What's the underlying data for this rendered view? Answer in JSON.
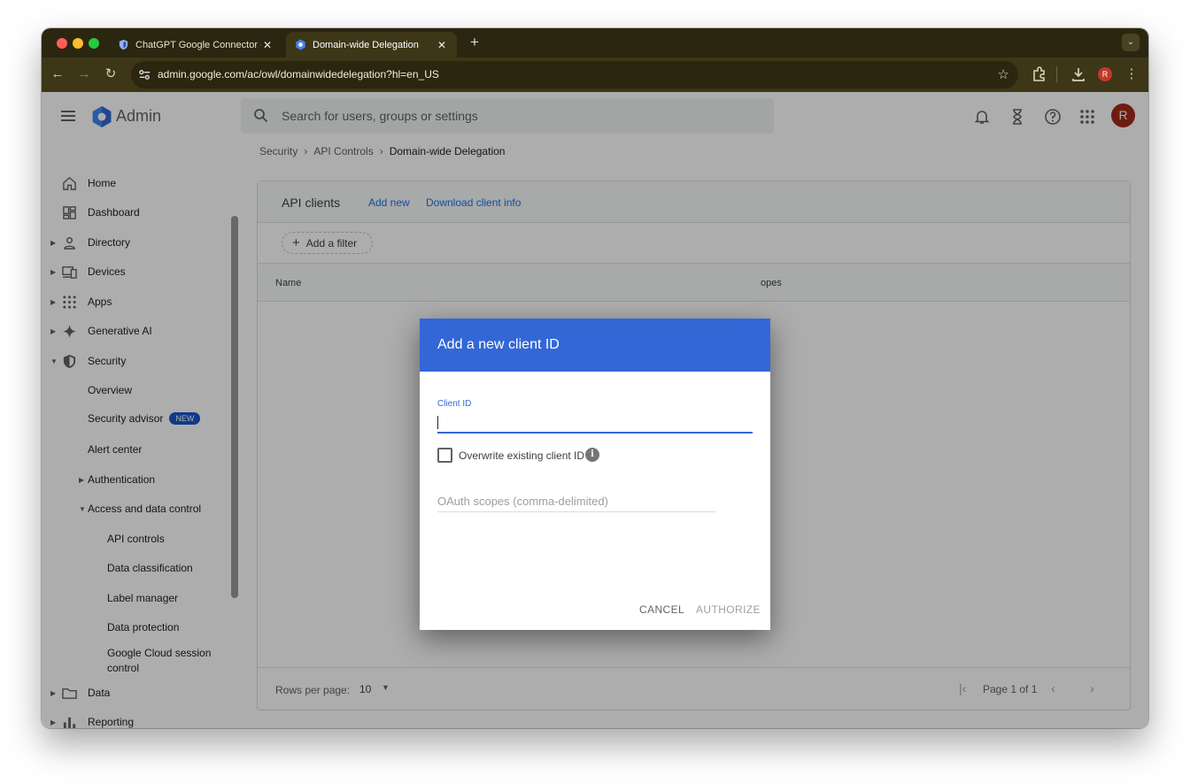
{
  "browser": {
    "tabs": [
      {
        "title": "ChatGPT Google Connector -",
        "active": false
      },
      {
        "title": "Domain-wide Delegation",
        "active": true
      }
    ],
    "url": "admin.google.com/ac/owl/domainwidedelegation?hl=en_US",
    "profile_initial": "R"
  },
  "app": {
    "brand": "Admin",
    "search_placeholder": "Search for users, groups or settings",
    "avatar_initial": "R"
  },
  "breadcrumb": [
    "Security",
    "API Controls",
    "Domain-wide Delegation"
  ],
  "sidebar": {
    "items": [
      {
        "label": "Home"
      },
      {
        "label": "Dashboard"
      },
      {
        "label": "Directory"
      },
      {
        "label": "Devices"
      },
      {
        "label": "Apps"
      },
      {
        "label": "Generative AI"
      },
      {
        "label": "Security"
      },
      {
        "label": "Overview"
      },
      {
        "label": "Security advisor",
        "badge": "NEW"
      },
      {
        "label": "Alert center"
      },
      {
        "label": "Authentication"
      },
      {
        "label": "Access and data control"
      },
      {
        "label": "API controls"
      },
      {
        "label": "Data classification"
      },
      {
        "label": "Label manager"
      },
      {
        "label": "Data protection"
      },
      {
        "label": "Google Cloud session"
      },
      {
        "label": "control"
      },
      {
        "label": "Data"
      },
      {
        "label": "Reporting"
      }
    ]
  },
  "card": {
    "title": "API clients",
    "add_new": "Add new",
    "download": "Download client info",
    "filter": "Add a filter",
    "col_name": "Name",
    "col_scopes": "opes",
    "rows_per_page_label": "Rows per page:",
    "rows_per_page_value": "10",
    "pager": "Page 1 of 1"
  },
  "dialog": {
    "title": "Add a new client ID",
    "client_id_label": "Client ID",
    "client_id_value": "",
    "overwrite_label": "Overwrite existing client ID",
    "overwrite_checked": false,
    "oauth_placeholder": "OAuth scopes (comma-delimited)",
    "cancel": "CANCEL",
    "authorize": "AUTHORIZE"
  }
}
